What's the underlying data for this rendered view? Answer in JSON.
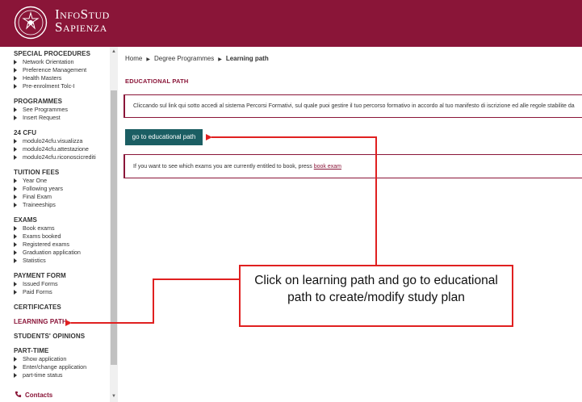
{
  "header": {
    "logo_line1": "InfoStud",
    "logo_line2": "Sapienza",
    "brand_color": "#8a1538"
  },
  "sidebar": {
    "sections": [
      {
        "title": "SPECIAL PROCEDURES",
        "items": [
          "Network Orientation",
          "Preference Management",
          "Health Masters",
          "Pre-enrolment Tolc-I"
        ]
      },
      {
        "title": "PROGRAMMES",
        "items": [
          "See Programmes",
          "Insert Request"
        ]
      },
      {
        "title": "24 CFU",
        "items": [
          "modulo24cfu.visualizza",
          "modulo24cfu.attestazione",
          "modulo24cfu.riconoscicrediti"
        ]
      },
      {
        "title": "TUITION FEES",
        "items": [
          "Year One",
          "Following years",
          "Final Exam",
          "Traineeships"
        ]
      },
      {
        "title": "EXAMS",
        "items": [
          "Book exams",
          "Exams booked",
          "Registered exams",
          "Graduation application",
          "Statistics"
        ]
      },
      {
        "title": "PAYMENT FORM",
        "items": [
          "Issued Forms",
          "Paid Forms"
        ]
      },
      {
        "title": "CERTIFICATES",
        "items": []
      },
      {
        "title": "LEARNING PATH",
        "items": [],
        "active": true
      },
      {
        "title": "STUDENTS' OPINIONS",
        "items": []
      },
      {
        "title": "PART-TIME",
        "items": [
          "Show application",
          "Enter/change application",
          "part-time status"
        ]
      }
    ],
    "contacts_label": "Contacts"
  },
  "breadcrumb": {
    "home": "Home",
    "level2": "Degree Programmes",
    "current": "Learning path"
  },
  "main": {
    "title": "EDUCATIONAL PATH",
    "info_text": "Cliccando sul link qui sotto accedi al sistema Percorsi Formativi, sul quale puoi gestire il tuo percorso formativo in accordo al tuo manifesto di iscrizione ed alle regole stabilite da",
    "button_label": "go to educational path",
    "exam_text": "If you want to see which exams you are currently entitled to book, press",
    "exam_link": "book exam"
  },
  "callout": {
    "text": "Click on learning path and go to educational path to create/modify study plan",
    "color": "#e02020"
  }
}
